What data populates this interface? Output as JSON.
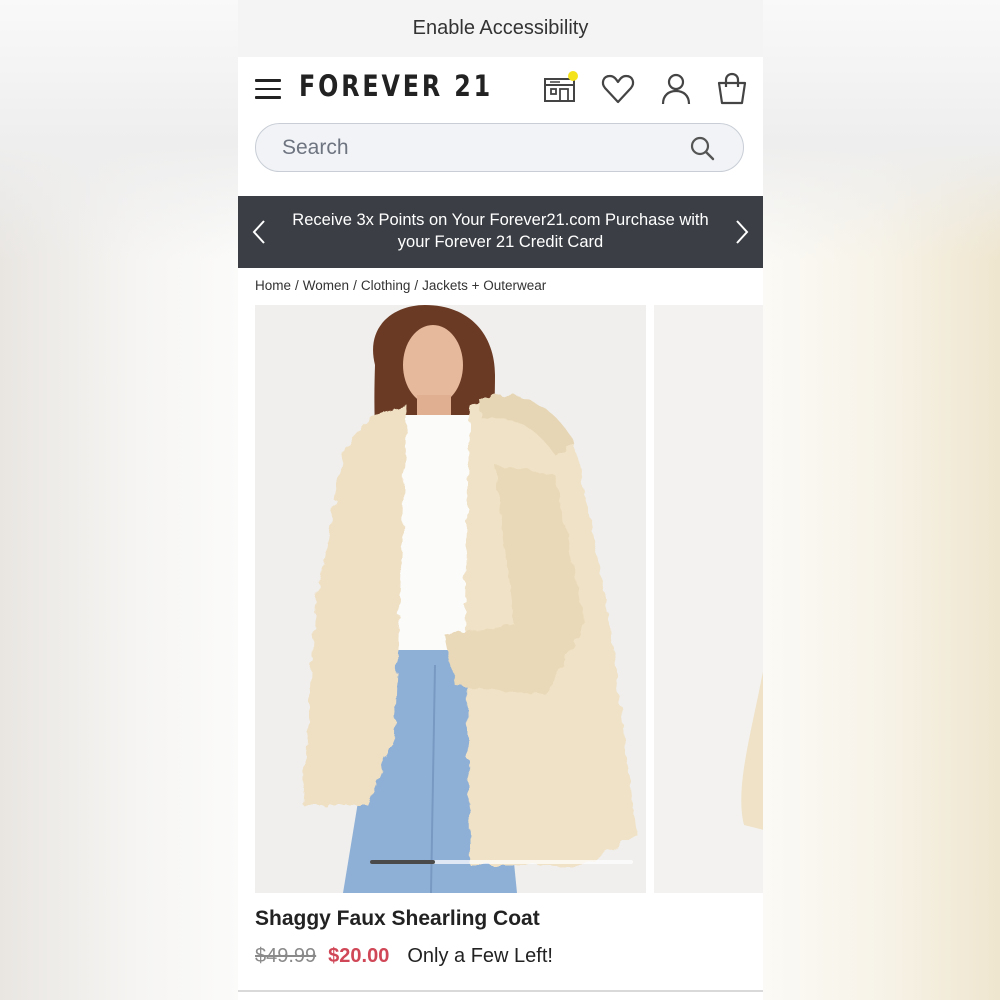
{
  "accessibility_bar": {
    "label": "Enable Accessibility"
  },
  "header": {
    "logo": "FOREVER 21",
    "icons": [
      "menu-icon",
      "store-icon",
      "heart-icon",
      "user-icon",
      "bag-icon"
    ],
    "store_indicator_color": "#f4e21b"
  },
  "search": {
    "placeholder": "Search",
    "value": ""
  },
  "promo": {
    "text": "Receive 3x Points on Your Forever21.com Purchase with your Forever 21 Credit Card",
    "background": "#3b3f45"
  },
  "breadcrumb": [
    "Home",
    "Women",
    "Clothing",
    "Jackets + Outerwear"
  ],
  "product": {
    "title": "Shaggy Faux Shearling Coat",
    "original_price": "$49.99",
    "sale_price": "$20.00",
    "stock_note": "Only a Few Left!",
    "sale_color": "#d04757",
    "images": [
      "model wearing cream shaggy faux shearling coat",
      "second product image"
    ],
    "gallery_position": "1 of 6"
  }
}
